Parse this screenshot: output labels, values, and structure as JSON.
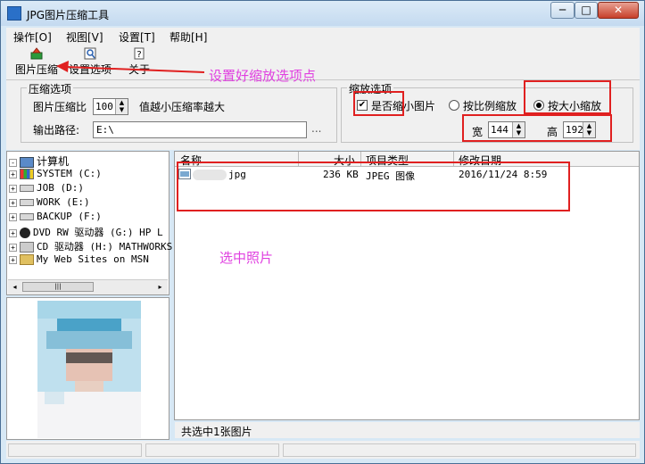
{
  "window": {
    "title": "JPG图片压缩工具",
    "min_label": "─",
    "max_label": "□",
    "close_label": "✕"
  },
  "menu": {
    "items": [
      "操作[O]",
      "视图[V]",
      "设置[T]",
      "帮助[H]"
    ]
  },
  "toolbar": {
    "compress_label": "图片压缩",
    "options_label": "设置选项",
    "about_label": "关于"
  },
  "compress_options": {
    "group_title": "压缩选项",
    "ratio_label": "图片压缩比",
    "ratio_value": "100",
    "ratio_hint": "值越小压缩率越大",
    "output_label": "输出路径:",
    "output_value": "E:\\",
    "browse_label": "..."
  },
  "scale_options": {
    "group_title": "缩放选项",
    "shrink_label": "是否缩小图片",
    "shrink_checked": true,
    "ratio_scale_label": "按比例缩放",
    "size_scale_label": "按大小缩放",
    "width_label": "宽",
    "width_value": "144",
    "height_label": "高",
    "height_value": "192"
  },
  "tree": {
    "items": [
      {
        "label": "计算机",
        "icon": "computer-icon",
        "expander": "-"
      },
      {
        "label": "SYSTEM (C:)",
        "icon": "system-drive-icon",
        "expander": "+"
      },
      {
        "label": "JOB (D:)",
        "icon": "drive-icon",
        "expander": "+"
      },
      {
        "label": "WORK (E:)",
        "icon": "drive-icon",
        "expander": "+"
      },
      {
        "label": "BACKUP (F:)",
        "icon": "drive-icon",
        "expander": "+"
      },
      {
        "label": "DVD RW 驱动器 (G:) HP L",
        "icon": "hp-dvd-icon",
        "expander": "+"
      },
      {
        "label": "CD 驱动器 (H:) MATHWORKS",
        "icon": "cd-drive-icon",
        "expander": "+"
      },
      {
        "label": "My Web Sites on MSN",
        "icon": "web-sites-icon",
        "expander": "+"
      }
    ],
    "scroll_left": "◂",
    "scroll_right": "▸",
    "scroll_thumb": "|||"
  },
  "file_list": {
    "columns": [
      "名称",
      "大小",
      "项目类型",
      "修改日期"
    ],
    "rows": [
      {
        "name": "jpg",
        "size": "236 KB",
        "type": "JPEG 图像",
        "date": "2016/11/24 8:59"
      }
    ],
    "status": "共选中1张图片"
  },
  "annotations": {
    "set_options": "设置好缩放选项点",
    "select_photo": "选中照片"
  },
  "colors": {
    "window_bg": "#d7e8f5",
    "annotation": "#e040e0",
    "highlight_box": "#e02020"
  }
}
